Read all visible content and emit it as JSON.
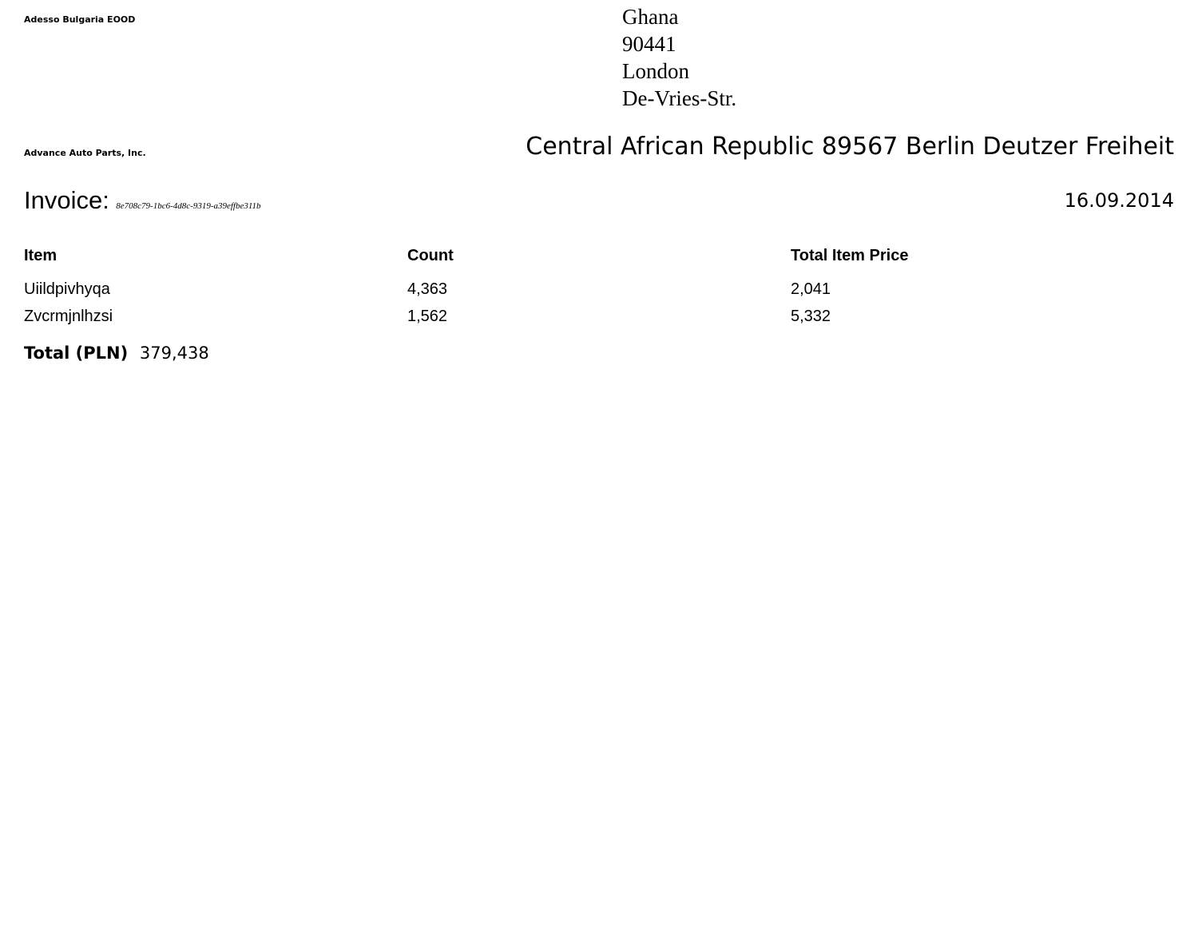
{
  "sender": {
    "name": "Adesso Bulgaria EOOD"
  },
  "recipient_address": {
    "lines": [
      "Ghana",
      "90441",
      "London",
      "De-Vries-Str."
    ]
  },
  "buyer": {
    "name": "Advance Auto Parts, Inc.",
    "address": "Central African Republic 89567 Berlin Deutzer Freiheit"
  },
  "invoice": {
    "label": "Invoice:",
    "id": "8e708c79-1bc6-4d8c-9319-a39effbe311b",
    "date": "16.09.2014"
  },
  "table": {
    "headers": [
      "Item",
      "Count",
      "Total Item Price"
    ],
    "rows": [
      [
        "Uiildpivhyqa",
        "4,363",
        "2,041"
      ],
      [
        "Zvcrmjnlhzsi",
        "1,562",
        "5,332"
      ]
    ]
  },
  "total": {
    "label": "Total (PLN)",
    "value": "379,438"
  }
}
